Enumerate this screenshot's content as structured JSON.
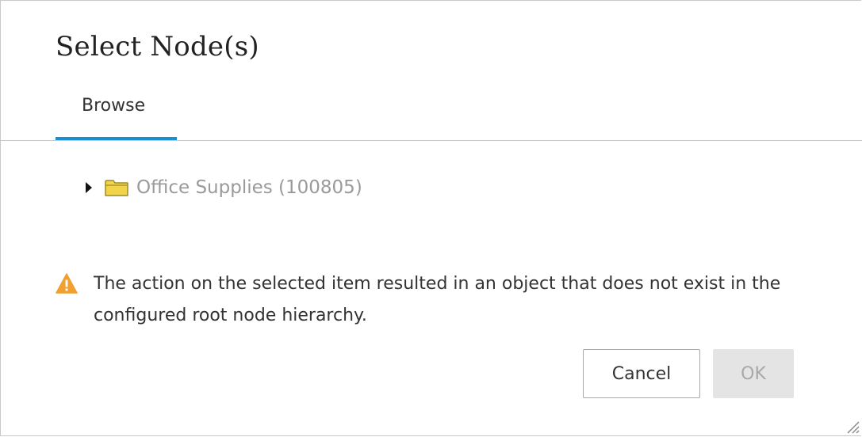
{
  "dialog": {
    "title": "Select Node(s)",
    "tabs": [
      {
        "label": "Browse",
        "active": true
      }
    ],
    "tree": {
      "items": [
        {
          "label": "Office Supplies (100805)",
          "expanded": false,
          "icon": "folder-icon"
        }
      ]
    },
    "warning": {
      "icon": "warning-icon",
      "message": "The action on the selected item resulted in an object that does not exist in the configured root node hierarchy."
    },
    "buttons": {
      "cancel_label": "Cancel",
      "ok_label": "OK",
      "ok_disabled": true
    }
  },
  "colors": {
    "accent": "#1a8fcf",
    "warning": "#f0a030",
    "folder": "#f2d44a",
    "muted_text": "#9a9a9a"
  }
}
